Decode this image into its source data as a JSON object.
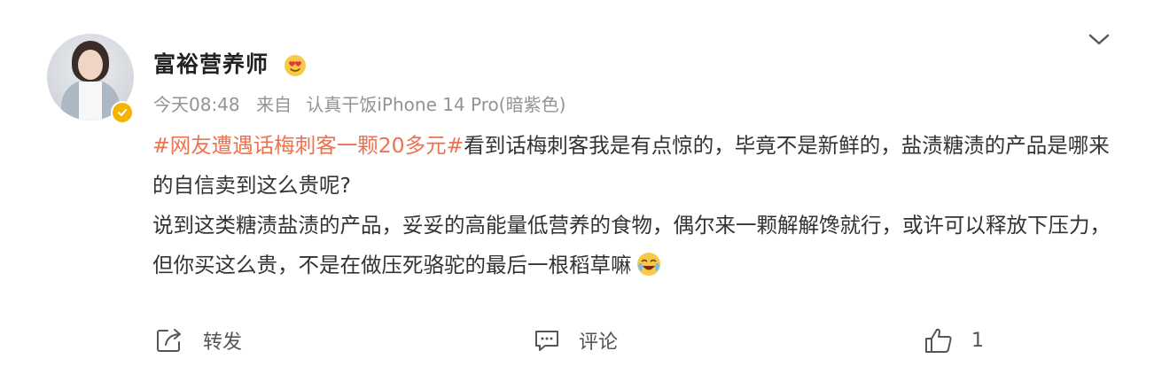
{
  "post": {
    "username": "富裕营养师",
    "time": "今天08:48",
    "source_prefix": "来自",
    "source": "认真干饭iPhone 14 Pro(暗紫色)",
    "hashtag": "#网友遭遇话梅刺客一颗20多元#",
    "line1_rest": "看到话梅刺客我是有点惊的，毕竟不是新鲜的，盐渍糖渍的产品是哪来的自信卖到这么贵呢?",
    "line2": "说到这类糖渍盐渍的产品，妥妥的高能量低营养的食物，偶尔来一颗解解馋就行，或许可以释放下压力，但你买这么贵，不是在做压死骆驼的最后一根稻草嘛",
    "emoji": "crying-laughing-emoji"
  },
  "actions": {
    "repost_label": "转发",
    "comment_label": "评论",
    "like_count": "1"
  },
  "colors": {
    "hashtag": "#eb7350",
    "meta": "#939393",
    "verified": "#f5b400"
  },
  "icons": {
    "expand": "chevron-down-icon",
    "repost": "repost-icon",
    "comment": "comment-icon",
    "like": "thumbs-up-icon",
    "verified": "verified-badge-icon",
    "user_badge": "heart-eyes-badge-icon"
  }
}
